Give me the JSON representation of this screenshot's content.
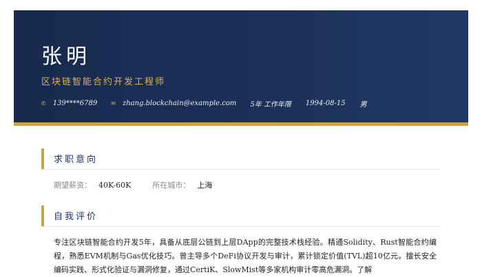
{
  "profile": {
    "name": "张明",
    "title": "区块链智能合约开发工程师",
    "phone": "139****6789",
    "email": "zhang.blockchain@example.com",
    "experience": "5年 工作年限",
    "birthdate": "1994-08-15",
    "gender": "男",
    "icons": {
      "phone": "phone-icon",
      "email": "mail-icon"
    }
  },
  "sections": {
    "intent": {
      "title": "求职意向",
      "salary_label": "期望薪资：",
      "salary_value": "40K-60K",
      "city_label": "所在城市：",
      "city_value": "上海"
    },
    "summary": {
      "title": "自我评价",
      "text": "专注区块链智能合约开发5年，具备从底层公链到上层DApp的完整技术栈经验。精通Solidity、Rust智能合约编程，熟悉EVM机制与Gas优化技巧。曾主导多个DeFi协议开发与审计，累计锁定价值(TVL)超10亿元。擅长安全编码实践、形式化验证与漏洞修复，通过CertiK、SlowMist等多家机构审计零高危漏洞。了解"
    }
  },
  "colors": {
    "header_bg": "#1c3058",
    "accent_gold": "#c9a445",
    "section_title": "#1f3560"
  }
}
